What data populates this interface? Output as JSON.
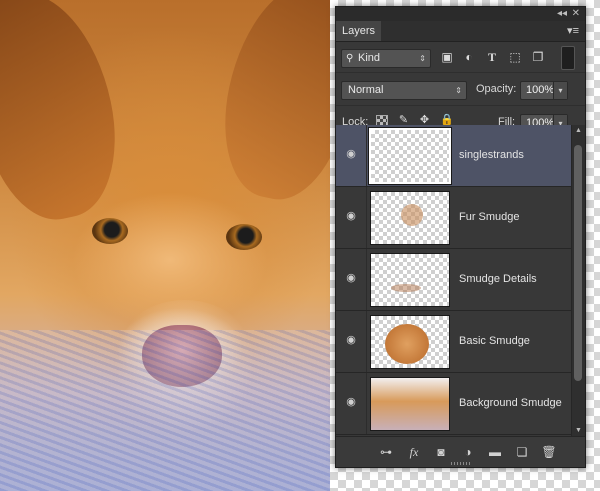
{
  "panel": {
    "title_tab": "Layers",
    "collapse_icon": "◂◂",
    "close_icon": "✕",
    "menu_icon": "▾≡"
  },
  "filter": {
    "kind_label": "Kind",
    "icons": [
      "image-filter-icon",
      "adjustment-filter-icon",
      "type-filter-icon",
      "shape-filter-icon",
      "smart-object-filter-icon"
    ]
  },
  "blend": {
    "mode": "Normal",
    "opacity_label": "Opacity:",
    "opacity_value": "100%",
    "lock_label": "Lock:",
    "fill_label": "Fill:",
    "fill_value": "100%"
  },
  "layers": [
    {
      "name": "singlestrands",
      "selected": true
    },
    {
      "name": "Fur Smudge",
      "selected": false
    },
    {
      "name": "Smudge Details",
      "selected": false
    },
    {
      "name": "Basic Smudge",
      "selected": false
    },
    {
      "name": "Background Smudge",
      "selected": false
    }
  ],
  "footer": {
    "buttons": [
      "link-layers-icon",
      "fx-icon",
      "add-mask-icon",
      "adjustment-layer-icon",
      "group-folder-icon",
      "new-layer-icon",
      "trash-icon"
    ],
    "fx_label": "fx"
  }
}
